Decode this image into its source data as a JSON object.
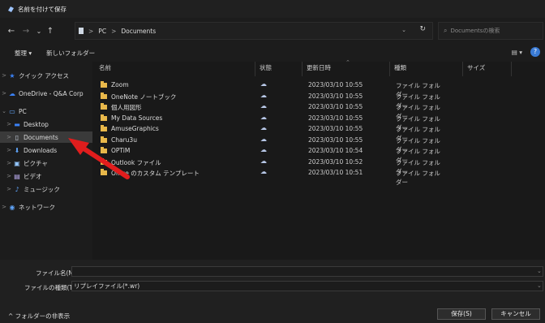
{
  "window": {
    "title": "名前を付けて保存"
  },
  "nav": {
    "back": "←",
    "forward": "→",
    "recent": "⌄",
    "up": "↑",
    "breadcrumbs": [
      "PC",
      "Documents"
    ],
    "separator": ">",
    "address_dropdown": "⌄",
    "refresh": "↻",
    "search_placeholder": "Documentsの検索"
  },
  "toolbar": {
    "organize": "整理 ▾",
    "new_folder": "新しいフォルダー",
    "view": "▤ ▾",
    "help": "?"
  },
  "sidebar": {
    "items": [
      {
        "label": "クイック アクセス",
        "icon": "star-icon",
        "glyph": "★",
        "color": "#3b82f6",
        "chev": ">"
      },
      {
        "label": "OneDrive - Q&A Corp",
        "icon": "cloud-icon",
        "glyph": "☁",
        "color": "#3b82f6",
        "chev": ">"
      },
      {
        "label": "PC",
        "icon": "pc-icon",
        "glyph": "▭",
        "color": "#60a5fa",
        "chev": "⌄"
      },
      {
        "label": "Desktop",
        "icon": "desktop-icon",
        "glyph": "▬",
        "color": "#3b82f6",
        "chev": ">"
      },
      {
        "label": "Documents",
        "icon": "documents-icon",
        "glyph": "▯",
        "color": "#cfd8e3",
        "chev": ">"
      },
      {
        "label": "Downloads",
        "icon": "download-icon",
        "glyph": "⬇",
        "color": "#60a5fa",
        "chev": ">"
      },
      {
        "label": "ピクチャ",
        "icon": "pictures-icon",
        "glyph": "▣",
        "color": "#93c5fd",
        "chev": ">"
      },
      {
        "label": "ビデオ",
        "icon": "video-icon",
        "glyph": "▤",
        "color": "#c4b5fd",
        "chev": ">"
      },
      {
        "label": "ミュージック",
        "icon": "music-icon",
        "glyph": "♪",
        "color": "#60a5fa",
        "chev": ">"
      },
      {
        "label": "ネットワーク",
        "icon": "network-icon",
        "glyph": "◉",
        "color": "#60a5fa",
        "chev": ">"
      }
    ]
  },
  "columns": {
    "name": "名前",
    "status": "状態",
    "date": "更新日時",
    "type": "種類",
    "size": "サイズ"
  },
  "files": [
    {
      "name": "Zoom",
      "status": "☁",
      "date": "2023/03/10 10:55",
      "type": "ファイル フォルダー"
    },
    {
      "name": "OneNote ノートブック",
      "status": "☁",
      "date": "2023/03/10 10:55",
      "type": "ファイル フォルダー"
    },
    {
      "name": "個人用図形",
      "status": "☁",
      "date": "2023/03/10 10:55",
      "type": "ファイル フォルダー"
    },
    {
      "name": "My Data Sources",
      "status": "☁",
      "date": "2023/03/10 10:55",
      "type": "ファイル フォルダー"
    },
    {
      "name": "AmuseGraphics",
      "status": "☁",
      "date": "2023/03/10 10:55",
      "type": "ファイル フォルダー"
    },
    {
      "name": "Charu3u",
      "status": "☁",
      "date": "2023/03/10 10:55",
      "type": "ファイル フォルダー"
    },
    {
      "name": "OPTiM",
      "status": "☁",
      "date": "2023/03/10 10:54",
      "type": "ファイル フォルダー"
    },
    {
      "name": "Outlook ファイル",
      "status": "☁",
      "date": "2023/03/10 10:52",
      "type": "ファイル フォルダー"
    },
    {
      "name": "Office のカスタム テンプレート",
      "status": "☁",
      "date": "2023/03/10 10:51",
      "type": "ファイル フォルダー"
    }
  ],
  "bottom": {
    "filename_label": "ファイル名(N):",
    "filename_value": "",
    "filetype_label": "ファイルの種類(T):",
    "filetype_value": "リプレイファイル(*.wr)",
    "hide_folders": "^ フォルダーの非表示",
    "save": "保存(S)",
    "cancel": "キャンセル"
  },
  "annotation": {
    "color": "#e11d1d"
  }
}
